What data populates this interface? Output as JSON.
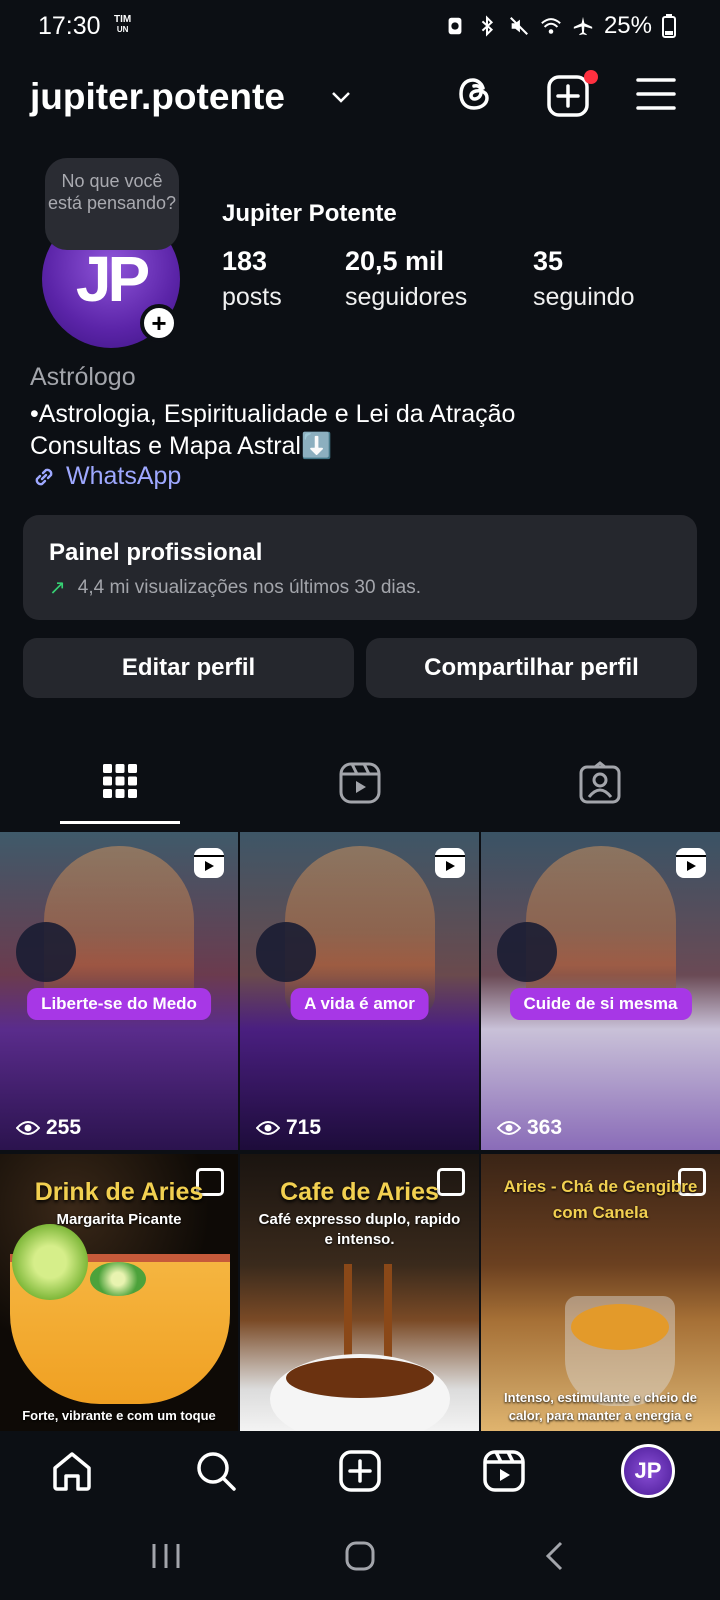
{
  "status_bar": {
    "time": "17:30",
    "carrier_top": "TIM",
    "carrier_bottom": "UN",
    "battery": "25%"
  },
  "header": {
    "username": "jupiter.potente"
  },
  "profile": {
    "note": "No que você está pensando?",
    "avatar_initials": "JP",
    "display_name": "Jupiter Potente",
    "stats": [
      {
        "value": "183",
        "label": "posts"
      },
      {
        "value": "20,5 mil",
        "label": "seguidores"
      },
      {
        "value": "35",
        "label": "seguindo"
      }
    ],
    "category": "Astrólogo",
    "bio_line1": "•Astrologia, Espiritualidade e Lei da Atração",
    "bio_line2": "Consultas e Mapa Astral⬇️",
    "link_label": "WhatsApp"
  },
  "pro_panel": {
    "title": "Painel profissional",
    "subtitle": "4,4 mi visualizações nos últimos 30 dias."
  },
  "actions": {
    "edit_label": "Editar perfil",
    "share_label": "Compartilhar perfil"
  },
  "grid": {
    "reels": [
      {
        "pill": "Liberte-se do Medo",
        "views": "255"
      },
      {
        "pill": "A vida é amor",
        "views": "715"
      },
      {
        "pill": "Cuide de si mesma",
        "views": "363"
      }
    ],
    "posts": [
      {
        "title": "Drink de Aries",
        "subtitle": "Margarita Picante",
        "bottom": "Forte, vibrante e com um toque"
      },
      {
        "title": "Cafe de Aries",
        "subtitle": "Café expresso duplo, rapido e intenso.",
        "bottom": ""
      },
      {
        "title": "Aries - Chá de Gengibre com Canela",
        "subtitle": "",
        "bottom": "Intenso, estimulante e cheio de calor, para manter a energia e"
      }
    ]
  },
  "bottom_nav": {
    "avatar_initials": "JP"
  },
  "colors": {
    "background": "#0c0f14",
    "panel": "#25272d",
    "link": "#9ea8ff",
    "accent_pill": "#a737e6",
    "notification": "#ff3040",
    "trend_up": "#36d073"
  }
}
